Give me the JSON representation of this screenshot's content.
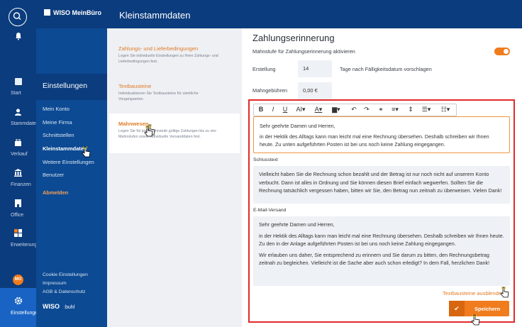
{
  "app": {
    "logo": "WISO MeinBüro",
    "page_title": "Kleinstammdaten"
  },
  "rail": {
    "items": [
      {
        "label": "Start",
        "icon": "start-icon"
      },
      {
        "label": "Stammdaten",
        "icon": "stammdaten-icon"
      },
      {
        "label": "Verkauf",
        "icon": "verkauf-icon"
      },
      {
        "label": "Finanzen",
        "icon": "finanzen-icon"
      },
      {
        "label": "Office",
        "icon": "office-icon"
      },
      {
        "label": "Erweiterungen",
        "icon": "erweiterungen-icon"
      },
      {
        "label": "Einstellungen",
        "icon": "gear-icon"
      }
    ],
    "avatar": "MO"
  },
  "settings_nav": {
    "heading": "Einstellungen",
    "items": [
      "Mein Konto",
      "Meine Firma",
      "Schnittstellen",
      "Kleinstammdaten",
      "Weitere Einstellungen",
      "Benutzer",
      "Abmelden"
    ],
    "footer": [
      "Cookie Einstellungen",
      "Impressum",
      "AGB & Datenschutz"
    ],
    "footer_logo": "WISO",
    "footer_logo_suffix": ":buhl"
  },
  "submenu": [
    {
      "title": "Zahlungs- und Lieferbedingungen",
      "desc": "Legen Sie individuelle Einstellungen zu Ihren Zahlungs- und Lieferbedingungen fest."
    },
    {
      "title": "Textbausteine",
      "desc": "Individualisieren Sie Textbausteine für sämtliche Vorgangsarten."
    },
    {
      "title": "Mahnwesen",
      "desc": "Legen Sie für jede Mahnstufe gültige Zahlungen bis zu vier Mahnstufen sowie individuelle Versanddaten fest."
    }
  ],
  "main": {
    "heading": "Zahlungserinnerung",
    "toggle_label": "Mahnstufe für Zahlungserinnerung aktivieren",
    "toggle_on": true,
    "erstellung_label": "Erstellung",
    "erstellung_value": "14",
    "erstellung_hint": "Tage nach Fälligkeitsdatum vorschlagen",
    "gebuehren_label": "Mahngebühren",
    "gebuehren_value": "0,00 €",
    "intro_text": [
      "Sehr geehrte Damen und Herren,",
      "in der Hektik des Alltags kann man leicht mal eine Rechnung übersehen. Deshalb schreiben wir Ihnen heute. Zu unten aufgeführten Posten ist bei uns noch keine Zahlung eingegangen."
    ],
    "schluss_label": "Schlusstext",
    "schluss_text": "Vielleicht haben Sie die Rechnung schon bezahlt und der Betrag ist nur noch nicht auf unserem Konto verbucht. Dann ist alles in Ordnung und Sie können diesen Brief einfach wegwerfen. Sollten Sie die Rechnung tatsächlich vergessen haben, bitten wir Sie, den Betrag nun zeitnah zu überweisen. Vielen Dank!",
    "email_label": "E-Mail-Versand",
    "email_text": [
      "Sehr geehrte Damen und Herren,",
      "in der Hektik des Alltags kann man leicht mal eine Rechnung übersehen. Deshalb schreiben wir Ihnen heute. Zu den in der Anlage aufgeführten Posten ist bei uns noch keine Zahlung eingegangen.",
      "Wir erlauben uns daher, Sie entsprechend zu erinnern und Sie darum zu bitten, den Rechnungsbetrag zeitnah zu begleichen. Vielleicht ist die Sache aber auch schon erledigt? In dem Fall, herzlichen Dank!"
    ],
    "hide_link": "Textbausteine ausblenden",
    "save_label": "Speichern"
  },
  "colors": {
    "navy": "#0b3c7d",
    "blue": "#0c4a93",
    "accent": "#f07c1e",
    "highlight": "#e02a2a"
  }
}
